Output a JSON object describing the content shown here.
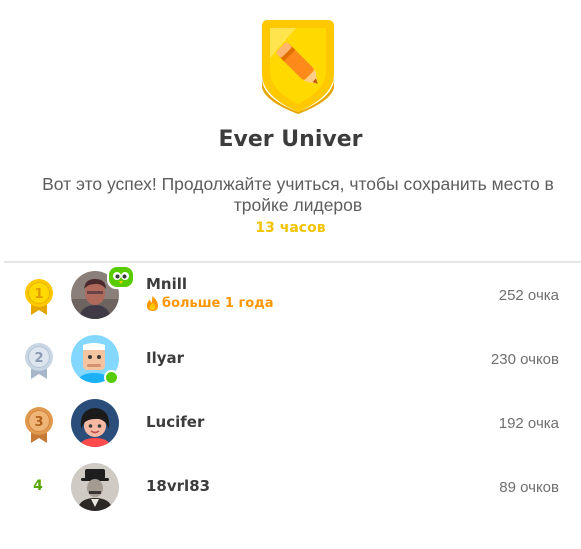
{
  "header": {
    "league_name": "Ever Univer",
    "message": "Вот это успех! Продолжайте учиться, чтобы сохранить место в тройке лидеров",
    "time_left": "13 часов"
  },
  "leaderboard": [
    {
      "rank": "1",
      "medal": "gold",
      "name": "Mnill",
      "streak": "больше 1 года",
      "xp": "252 очка",
      "has_owl_badge": true,
      "online": false
    },
    {
      "rank": "2",
      "medal": "silver",
      "name": "Ilyar",
      "streak": "",
      "xp": "230 очков",
      "has_owl_badge": false,
      "online": true
    },
    {
      "rank": "3",
      "medal": "bronze",
      "name": "Lucifer",
      "streak": "",
      "xp": "192 очка",
      "has_owl_badge": false,
      "online": false
    },
    {
      "rank": "4",
      "medal": "",
      "name": "18vrl83",
      "streak": "",
      "xp": "89 очков",
      "has_owl_badge": false,
      "online": false
    }
  ],
  "colors": {
    "gold": "#ffc800",
    "silver": "#c9d6e3",
    "bronze": "#e0994f",
    "streak": "#ff9600",
    "rank_text": "#58a700",
    "online": "#58cc02"
  }
}
